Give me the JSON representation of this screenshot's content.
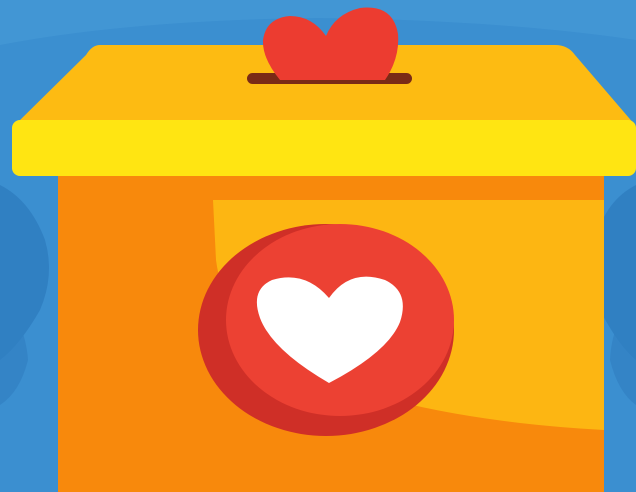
{
  "illustration": {
    "subject": "donation-box-with-heart",
    "icons": [
      "heart-icon",
      "donation-box-icon"
    ],
    "colors": {
      "background": "#3b8fd0",
      "background_dark": "#2f7cbf",
      "background_light": "#4fa3de",
      "lid_top": "#fdbb12",
      "lid_front": "#ffe512",
      "box_front_dark": "#f8890c",
      "box_front_light": "#fdb612",
      "slot": "#7a2a16",
      "heart_red": "#ec3c30",
      "badge_red": "#ec4133",
      "badge_shadow": "#cf2f27",
      "heart_white": "#ffffff"
    }
  }
}
